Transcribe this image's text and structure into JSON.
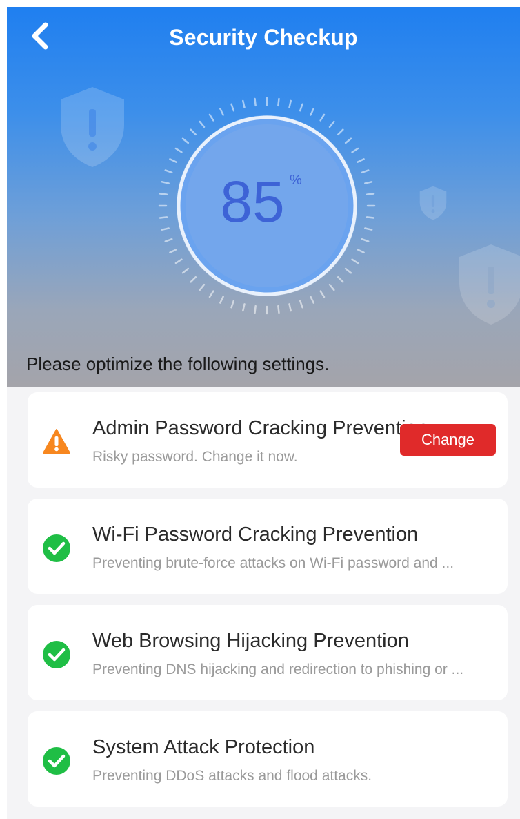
{
  "header": {
    "title": "Security Checkup",
    "back_icon": "chevron-left-icon"
  },
  "score": {
    "value": "85",
    "unit": "%"
  },
  "notice": "Please optimize the following settings.",
  "colors": {
    "accent": "#1f7ff0",
    "score": "#3d63d6",
    "warning": "#f7871f",
    "ok": "#1fbe45",
    "danger": "#e02a2a"
  },
  "items": [
    {
      "name": "Admin Password Cracking Prevention",
      "desc": "Risky password. Change it now.",
      "status": "warning-icon",
      "action": "Change"
    },
    {
      "name": "Wi-Fi Password Cracking Prevention",
      "desc": "Preventing brute-force attacks on Wi-Fi password and ...",
      "status": "check-circle-icon"
    },
    {
      "name": "Web Browsing Hijacking Prevention",
      "desc": "Preventing DNS hijacking and redirection to phishing or ...",
      "status": "check-circle-icon"
    },
    {
      "name": "System Attack Protection",
      "desc": "Preventing DDoS attacks and flood attacks.",
      "status": "check-circle-icon"
    }
  ]
}
